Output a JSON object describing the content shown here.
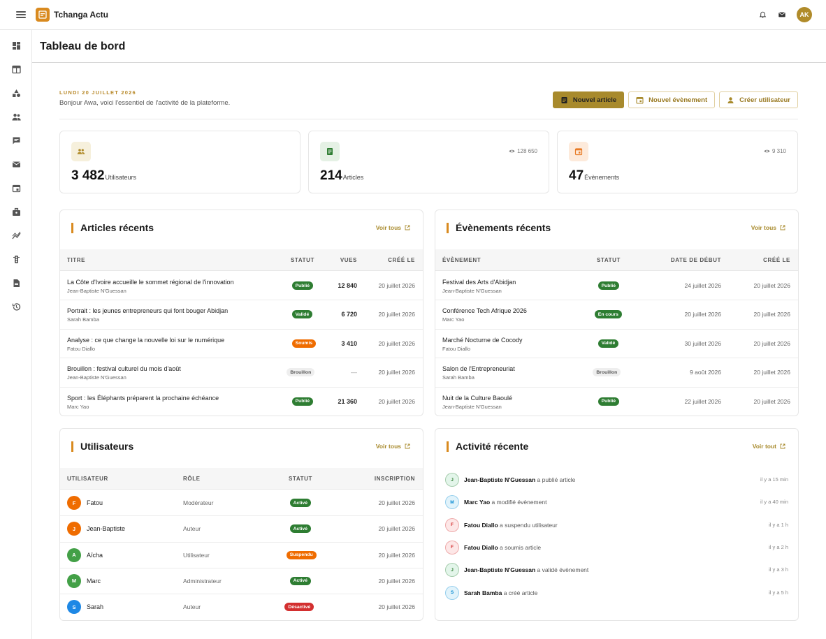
{
  "app": {
    "title": "Tchanga Actu",
    "user_initials": "AK"
  },
  "page": {
    "title": "Tableau de bord",
    "date": "LUNDI 20 JUILLET 2026",
    "greeting": "Bonjour Awa, voici l'essentiel de l'activité de la plateforme."
  },
  "actions": {
    "new_article": "Nouvel article",
    "new_event": "Nouvel évènement",
    "create_user": "Créer utilisateur"
  },
  "stats": [
    {
      "value": "3 482",
      "label": "Utilisateurs",
      "views": "",
      "color": "#b08b2a"
    },
    {
      "value": "214",
      "label": "Articles",
      "views": "128 650",
      "color": "#2e7d32"
    },
    {
      "value": "47",
      "label": "Évènements",
      "views": "9 310",
      "color": "#e87b26"
    }
  ],
  "articles": {
    "title": "Articles récents",
    "link": "Voir tous",
    "headers": [
      "TITRE",
      "STATUT",
      "VUES",
      "CRÉÉ LE"
    ],
    "rows": [
      {
        "title": "La Côte d'Ivoire accueille le sommet régional de l'innovation",
        "author": "Jean-Baptiste N'Guessan",
        "status": "Publié",
        "status_color": "#2e7d32",
        "views": "12 840",
        "created": "20 juillet 2026"
      },
      {
        "title": "Portrait : les jeunes entrepreneurs qui font bouger Abidjan",
        "author": "Sarah Bamba",
        "status": "Validé",
        "status_color": "#2e7d32",
        "views": "6 720",
        "created": "20 juillet 2026"
      },
      {
        "title": "Analyse : ce que change la nouvelle loi sur le numérique",
        "author": "Fatou Diallo",
        "status": "Soumis",
        "status_color": "#ef6c00",
        "views": "3 410",
        "created": "20 juillet 2026"
      },
      {
        "title": "Brouillon : festival culturel du mois d'août",
        "author": "Jean-Baptiste N'Guessan",
        "status": "Brouillon",
        "status_color": "#eeeeee",
        "views": "—",
        "created": "20 juillet 2026"
      },
      {
        "title": "Sport : les Éléphants préparent la prochaine échéance",
        "author": "Marc Yao",
        "status": "Publié",
        "status_color": "#2e7d32",
        "views": "21 360",
        "created": "20 juillet 2026"
      }
    ]
  },
  "events": {
    "title": "Évènements récents",
    "link": "Voir tous",
    "headers": [
      "ÉVÈNEMENT",
      "STATUT",
      "DATE DE DÉBUT",
      "CRÉÉ LE"
    ],
    "rows": [
      {
        "title": "Festival des Arts d'Abidjan",
        "author": "Jean-Baptiste N'Guessan",
        "status": "Publié",
        "status_color": "#2e7d32",
        "start": "24 juillet 2026",
        "created": "20 juillet 2026"
      },
      {
        "title": "Conférence Tech Afrique 2026",
        "author": "Marc Yao",
        "status": "En cours",
        "status_color": "#2e7d32",
        "start": "20 juillet 2026",
        "created": "20 juillet 2026"
      },
      {
        "title": "Marché Nocturne de Cocody",
        "author": "Fatou Diallo",
        "status": "Validé",
        "status_color": "#2e7d32",
        "start": "30 juillet 2026",
        "created": "20 juillet 2026"
      },
      {
        "title": "Salon de l'Entrepreneuriat",
        "author": "Sarah Bamba",
        "status": "Brouillon",
        "status_color": "#eeeeee",
        "start": "9 août 2026",
        "created": "20 juillet 2026"
      },
      {
        "title": "Nuit de la Culture Baoulé",
        "author": "Jean-Baptiste N'Guessan",
        "status": "Publié",
        "status_color": "#2e7d32",
        "start": "22 juillet 2026",
        "created": "20 juillet 2026"
      }
    ]
  },
  "users": {
    "title": "Utilisateurs",
    "link": "Voir tous",
    "headers": [
      "UTILISATEUR",
      "RÔLE",
      "STATUT",
      "INSCRIPTION"
    ],
    "rows": [
      {
        "initial": "F",
        "name": "Fatou",
        "avatar_color": "#ef6c00",
        "role": "Modérateur",
        "status": "Activé",
        "status_color": "#2e7d32",
        "joined": "20 juillet 2026"
      },
      {
        "initial": "J",
        "name": "Jean-Baptiste",
        "avatar_color": "#ef6c00",
        "role": "Auteur",
        "status": "Activé",
        "status_color": "#2e7d32",
        "joined": "20 juillet 2026"
      },
      {
        "initial": "A",
        "name": "Aïcha",
        "avatar_color": "#43a047",
        "role": "Utilisateur",
        "status": "Suspendu",
        "status_color": "#ef6c00",
        "joined": "20 juillet 2026"
      },
      {
        "initial": "M",
        "name": "Marc",
        "avatar_color": "#43a047",
        "role": "Administrateur",
        "status": "Activé",
        "status_color": "#2e7d32",
        "joined": "20 juillet 2026"
      },
      {
        "initial": "S",
        "name": "Sarah",
        "avatar_color": "#1e88e5",
        "role": "Auteur",
        "status": "Désactivé",
        "status_color": "#d32f2f",
        "joined": "20 juillet 2026"
      }
    ]
  },
  "activity": {
    "title": "Activité récente",
    "link": "Voir tout",
    "items": [
      {
        "initial": "J",
        "name": "Jean-Baptiste N'Guessan",
        "action": "a publié article",
        "when": "il y a 15 min",
        "bg": "#e3f5ea",
        "fg": "#2e7d32"
      },
      {
        "initial": "M",
        "name": "Marc Yao",
        "action": "a modifié évènement",
        "when": "il y a 40 min",
        "bg": "#e1f3fb",
        "fg": "#0288d1"
      },
      {
        "initial": "F",
        "name": "Fatou Diallo",
        "action": "a suspendu utilisateur",
        "when": "il y a 1 h",
        "bg": "#fde7e7",
        "fg": "#d32f2f"
      },
      {
        "initial": "F",
        "name": "Fatou Diallo",
        "action": "a soumis article",
        "when": "il y a 2 h",
        "bg": "#fde7e7",
        "fg": "#d32f2f"
      },
      {
        "initial": "J",
        "name": "Jean-Baptiste N'Guessan",
        "action": "a validé évènement",
        "when": "il y a 3 h",
        "bg": "#e3f5ea",
        "fg": "#2e7d32"
      },
      {
        "initial": "S",
        "name": "Sarah Bamba",
        "action": "a créé article",
        "when": "il y a 5 h",
        "bg": "#e1f3fb",
        "fg": "#0288d1"
      }
    ]
  },
  "sidebar": {
    "items": [
      "dashboard-icon",
      "layout-icon",
      "categories-icon",
      "users-icon",
      "comments-icon",
      "mail-icon",
      "calendar-icon",
      "jobs-icon",
      "analytics-icon",
      "traffic-icon",
      "document-icon",
      "history-icon"
    ]
  }
}
